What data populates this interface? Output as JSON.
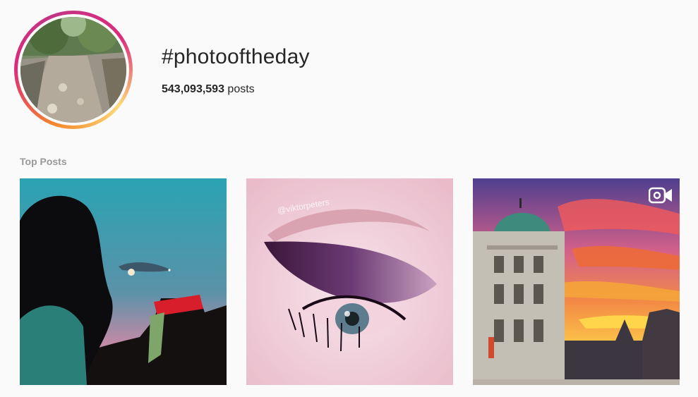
{
  "header": {
    "hashtag": "#photooftheday",
    "post_count": "543,093,593",
    "post_suffix": " posts"
  },
  "section": {
    "title": "Top Posts"
  },
  "posts": [
    {
      "id": "post-1",
      "media": "photo",
      "watermark": ""
    },
    {
      "id": "post-2",
      "media": "photo",
      "watermark": "@viktorpeters"
    },
    {
      "id": "post-3",
      "media": "video",
      "icon": "video-camera-icon",
      "watermark": ""
    }
  ],
  "colors": {
    "ring_orange": "#f58529",
    "ring_pink": "#dd2a7b",
    "text": "#262626",
    "muted": "#999999"
  }
}
